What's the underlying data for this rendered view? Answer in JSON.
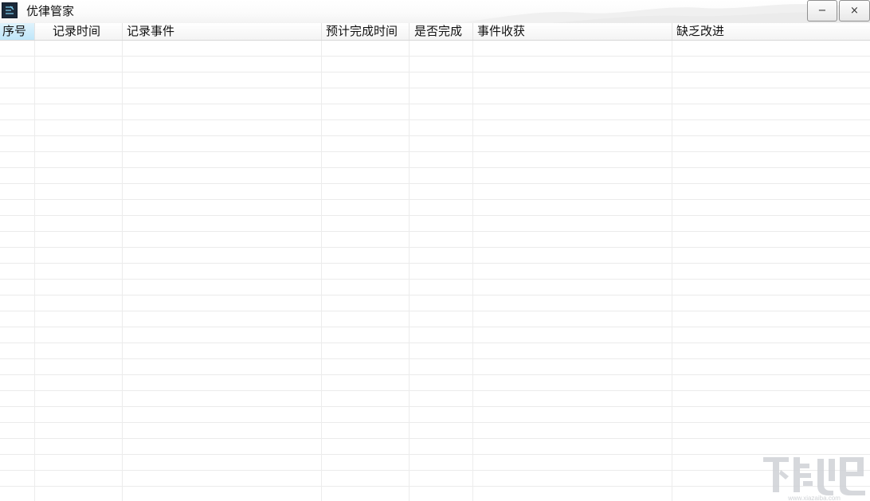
{
  "window": {
    "title": "优律管家",
    "minimize_label": "−",
    "close_label": "×",
    "icon": "app-logo-icon"
  },
  "table": {
    "columns": [
      {
        "label": "序号"
      },
      {
        "label": "记录时间"
      },
      {
        "label": "记录事件"
      },
      {
        "label": "预计完成时间"
      },
      {
        "label": "是否完成"
      },
      {
        "label": "事件收获"
      },
      {
        "label": "缺乏改进"
      }
    ],
    "rows": []
  },
  "watermark": {
    "text": "下载吧",
    "url": "www.xiazaiba.com"
  },
  "colors": {
    "header_active": "#bfe6f9",
    "grid_line": "#ebebeb"
  }
}
